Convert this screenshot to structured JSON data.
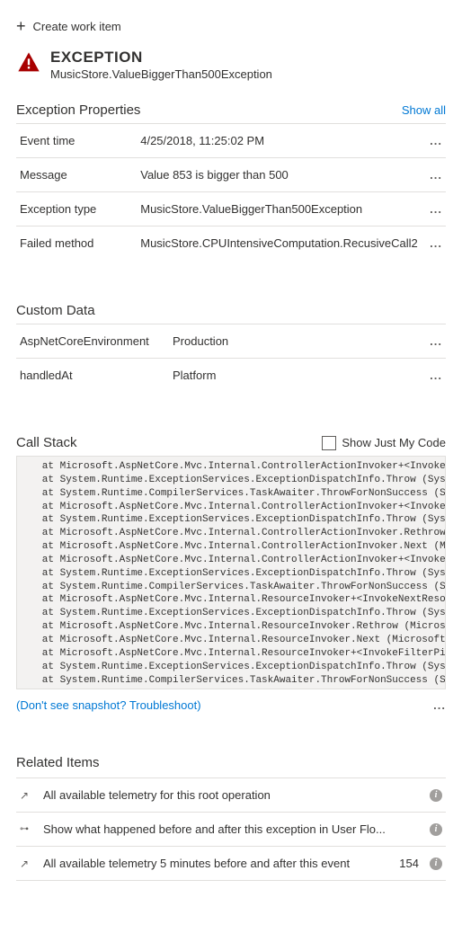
{
  "create_work_item": "Create work item",
  "exception": {
    "title": "EXCEPTION",
    "subtitle": "MusicStore.ValueBiggerThan500Exception"
  },
  "properties": {
    "heading": "Exception Properties",
    "show_all": "Show all",
    "rows": [
      {
        "label": "Event time",
        "value": "4/25/2018, 11:25:02 PM"
      },
      {
        "label": "Message",
        "value": "Value 853 is bigger than 500"
      },
      {
        "label": "Exception type",
        "value": "MusicStore.ValueBiggerThan500Exception"
      },
      {
        "label": "Failed method",
        "value": "MusicStore.CPUIntensiveComputation.RecusiveCall2"
      }
    ]
  },
  "custom_data": {
    "heading": "Custom Data",
    "rows": [
      {
        "label": "AspNetCoreEnvironment",
        "value": "Production"
      },
      {
        "label": "handledAt",
        "value": "Platform"
      }
    ]
  },
  "call_stack": {
    "heading": "Call Stack",
    "show_just_my_code": "Show Just My Code",
    "troubleshoot": "(Don't see snapshot? Troubleshoot)",
    "content": "   at Microsoft.AspNetCore.Mvc.Internal.ControllerActionInvoker+<Invoke\n   at System.Runtime.ExceptionServices.ExceptionDispatchInfo.Throw (Sys\n   at System.Runtime.CompilerServices.TaskAwaiter.ThrowForNonSuccess (S\n   at Microsoft.AspNetCore.Mvc.Internal.ControllerActionInvoker+<Invoke\n   at System.Runtime.ExceptionServices.ExceptionDispatchInfo.Throw (Sys\n   at Microsoft.AspNetCore.Mvc.Internal.ControllerActionInvoker.Rethrow\n   at Microsoft.AspNetCore.Mvc.Internal.ControllerActionInvoker.Next (M\n   at Microsoft.AspNetCore.Mvc.Internal.ControllerActionInvoker+<Invoke\n   at System.Runtime.ExceptionServices.ExceptionDispatchInfo.Throw (Sys\n   at System.Runtime.CompilerServices.TaskAwaiter.ThrowForNonSuccess (S\n   at Microsoft.AspNetCore.Mvc.Internal.ResourceInvoker+<InvokeNextReso\n   at System.Runtime.ExceptionServices.ExceptionDispatchInfo.Throw (Sys\n   at Microsoft.AspNetCore.Mvc.Internal.ResourceInvoker.Rethrow (Micros\n   at Microsoft.AspNetCore.Mvc.Internal.ResourceInvoker.Next (Microsoft\n   at Microsoft.AspNetCore.Mvc.Internal.ResourceInvoker+<InvokeFilterPi\n   at System.Runtime.ExceptionServices.ExceptionDispatchInfo.Throw (Sys\n   at System.Runtime.CompilerServices.TaskAwaiter.ThrowForNonSuccess (S"
  },
  "related": {
    "heading": "Related Items",
    "items": [
      {
        "text": "All available telemetry for this root operation",
        "count": ""
      },
      {
        "text": "Show what happened before and after this exception in User Flo...",
        "count": ""
      },
      {
        "text": "All available telemetry 5 minutes before and after this event",
        "count": "154"
      }
    ]
  }
}
